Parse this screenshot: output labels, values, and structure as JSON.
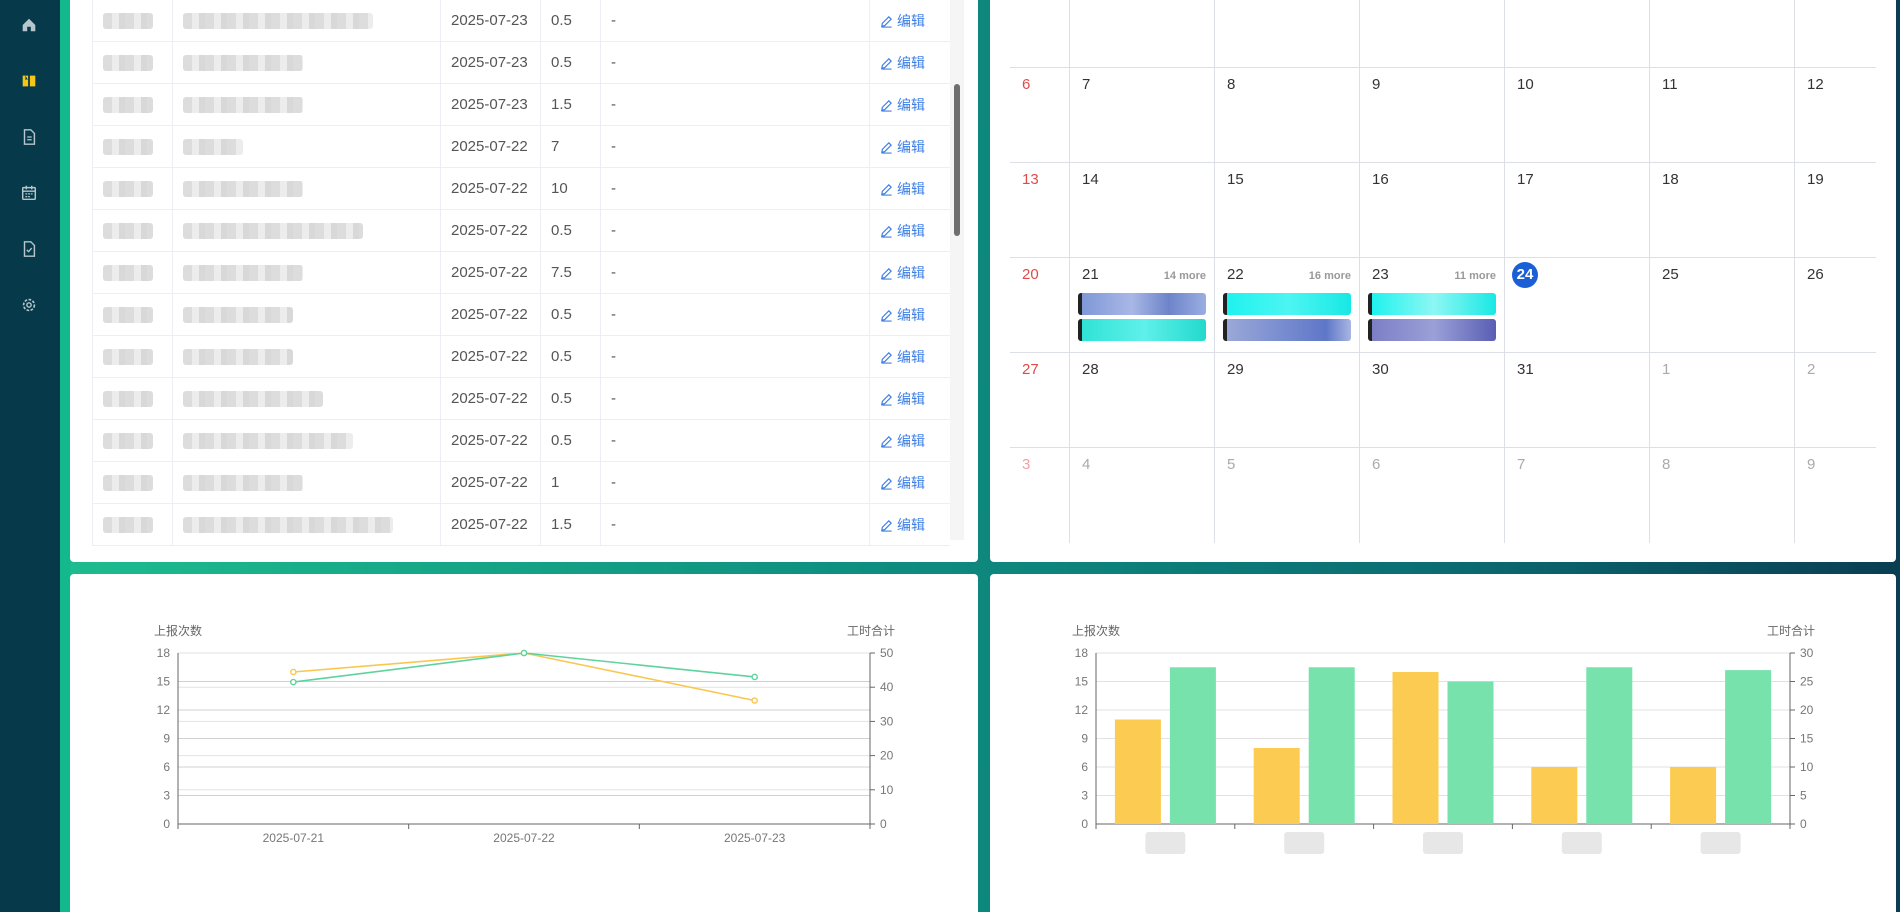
{
  "sidebar": {
    "items": [
      {
        "icon": "home-icon"
      },
      {
        "icon": "book-icon",
        "active": true
      },
      {
        "icon": "document-icon"
      },
      {
        "icon": "calendar-icon"
      },
      {
        "icon": "file-check-icon"
      },
      {
        "icon": "settings-icon"
      }
    ],
    "active_color": "#f5c518",
    "icon_color": "#b5c6cc"
  },
  "table": {
    "edit_label": "编辑",
    "rows": [
      {
        "date": "2025-07-23",
        "hours": "0.5",
        "note": "-"
      },
      {
        "date": "2025-07-23",
        "hours": "0.5",
        "note": "-"
      },
      {
        "date": "2025-07-23",
        "hours": "1.5",
        "note": "-"
      },
      {
        "date": "2025-07-22",
        "hours": "7",
        "note": "-"
      },
      {
        "date": "2025-07-22",
        "hours": "10",
        "note": "-"
      },
      {
        "date": "2025-07-22",
        "hours": "0.5",
        "note": "-"
      },
      {
        "date": "2025-07-22",
        "hours": "7.5",
        "note": "-"
      },
      {
        "date": "2025-07-22",
        "hours": "0.5",
        "note": "-"
      },
      {
        "date": "2025-07-22",
        "hours": "0.5",
        "note": "-"
      },
      {
        "date": "2025-07-22",
        "hours": "0.5",
        "note": "-"
      },
      {
        "date": "2025-07-22",
        "hours": "0.5",
        "note": "-"
      },
      {
        "date": "2025-07-22",
        "hours": "1",
        "note": "-"
      },
      {
        "date": "2025-07-22",
        "hours": "1.5",
        "note": "-"
      }
    ]
  },
  "calendar": {
    "today_color": "#1a5fd6",
    "sunday_color": "#e14a4a",
    "weeks": [
      [
        {
          "d": ""
        },
        {
          "d": ""
        },
        {
          "d": ""
        },
        {
          "d": ""
        },
        {
          "d": ""
        },
        {
          "d": ""
        },
        {
          "d": ""
        }
      ],
      [
        {
          "d": "6",
          "sun": true
        },
        {
          "d": "7"
        },
        {
          "d": "8"
        },
        {
          "d": "9"
        },
        {
          "d": "10"
        },
        {
          "d": "11"
        },
        {
          "d": "12"
        }
      ],
      [
        {
          "d": "13",
          "sun": true
        },
        {
          "d": "14"
        },
        {
          "d": "15"
        },
        {
          "d": "16"
        },
        {
          "d": "17"
        },
        {
          "d": "18"
        },
        {
          "d": "19"
        }
      ],
      [
        {
          "d": "20",
          "sun": true
        },
        {
          "d": "21",
          "more": "14 more",
          "events": 2
        },
        {
          "d": "22",
          "more": "16 more",
          "events": 2
        },
        {
          "d": "23",
          "more": "11 more",
          "events": 2
        },
        {
          "d": "24",
          "today": true
        },
        {
          "d": "25"
        },
        {
          "d": "26"
        }
      ],
      [
        {
          "d": "27",
          "sun": true
        },
        {
          "d": "28"
        },
        {
          "d": "29"
        },
        {
          "d": "30"
        },
        {
          "d": "31"
        },
        {
          "d": "1",
          "other": true
        },
        {
          "d": "2",
          "other": true
        }
      ],
      [
        {
          "d": "3",
          "sun": true,
          "other": true
        },
        {
          "d": "4",
          "other": true
        },
        {
          "d": "5",
          "other": true
        },
        {
          "d": "6",
          "other": true
        },
        {
          "d": "7",
          "other": true
        },
        {
          "d": "8",
          "other": true
        },
        {
          "d": "9",
          "other": true
        }
      ]
    ]
  },
  "chart_data": [
    {
      "type": "line",
      "x": [
        "2025-07-21",
        "2025-07-22",
        "2025-07-23"
      ],
      "ylabel": "上报次数",
      "y2label": "工时合计",
      "ylim": [
        0,
        18
      ],
      "y_ticks": [
        0,
        3,
        6,
        9,
        12,
        15,
        18
      ],
      "y2lim": [
        0,
        50
      ],
      "y2_ticks": [
        0,
        10,
        20,
        30,
        40,
        50
      ],
      "grid": true,
      "series": [
        {
          "axis": "left",
          "color": "#f9c74f",
          "values": [
            16,
            18,
            13
          ]
        },
        {
          "axis": "right",
          "color": "#5dd39e",
          "values": [
            41.5,
            50,
            43
          ]
        }
      ]
    },
    {
      "type": "bar",
      "categories": [
        "",
        "",
        "",
        "",
        ""
      ],
      "ylabel": "上报次数",
      "y2label": "工时合计",
      "ylim": [
        0,
        18
      ],
      "y_ticks": [
        0,
        3,
        6,
        9,
        12,
        15,
        18
      ],
      "y2lim": [
        0,
        30
      ],
      "y2_ticks": [
        0,
        5,
        10,
        15,
        20,
        25,
        30
      ],
      "grid": true,
      "series": [
        {
          "axis": "left",
          "color": "#fccb52",
          "values": [
            11,
            8,
            16,
            6,
            6
          ]
        },
        {
          "axis": "right",
          "color": "#78e2ad",
          "values": [
            27.5,
            27.5,
            25,
            27.5,
            27
          ]
        }
      ]
    }
  ]
}
